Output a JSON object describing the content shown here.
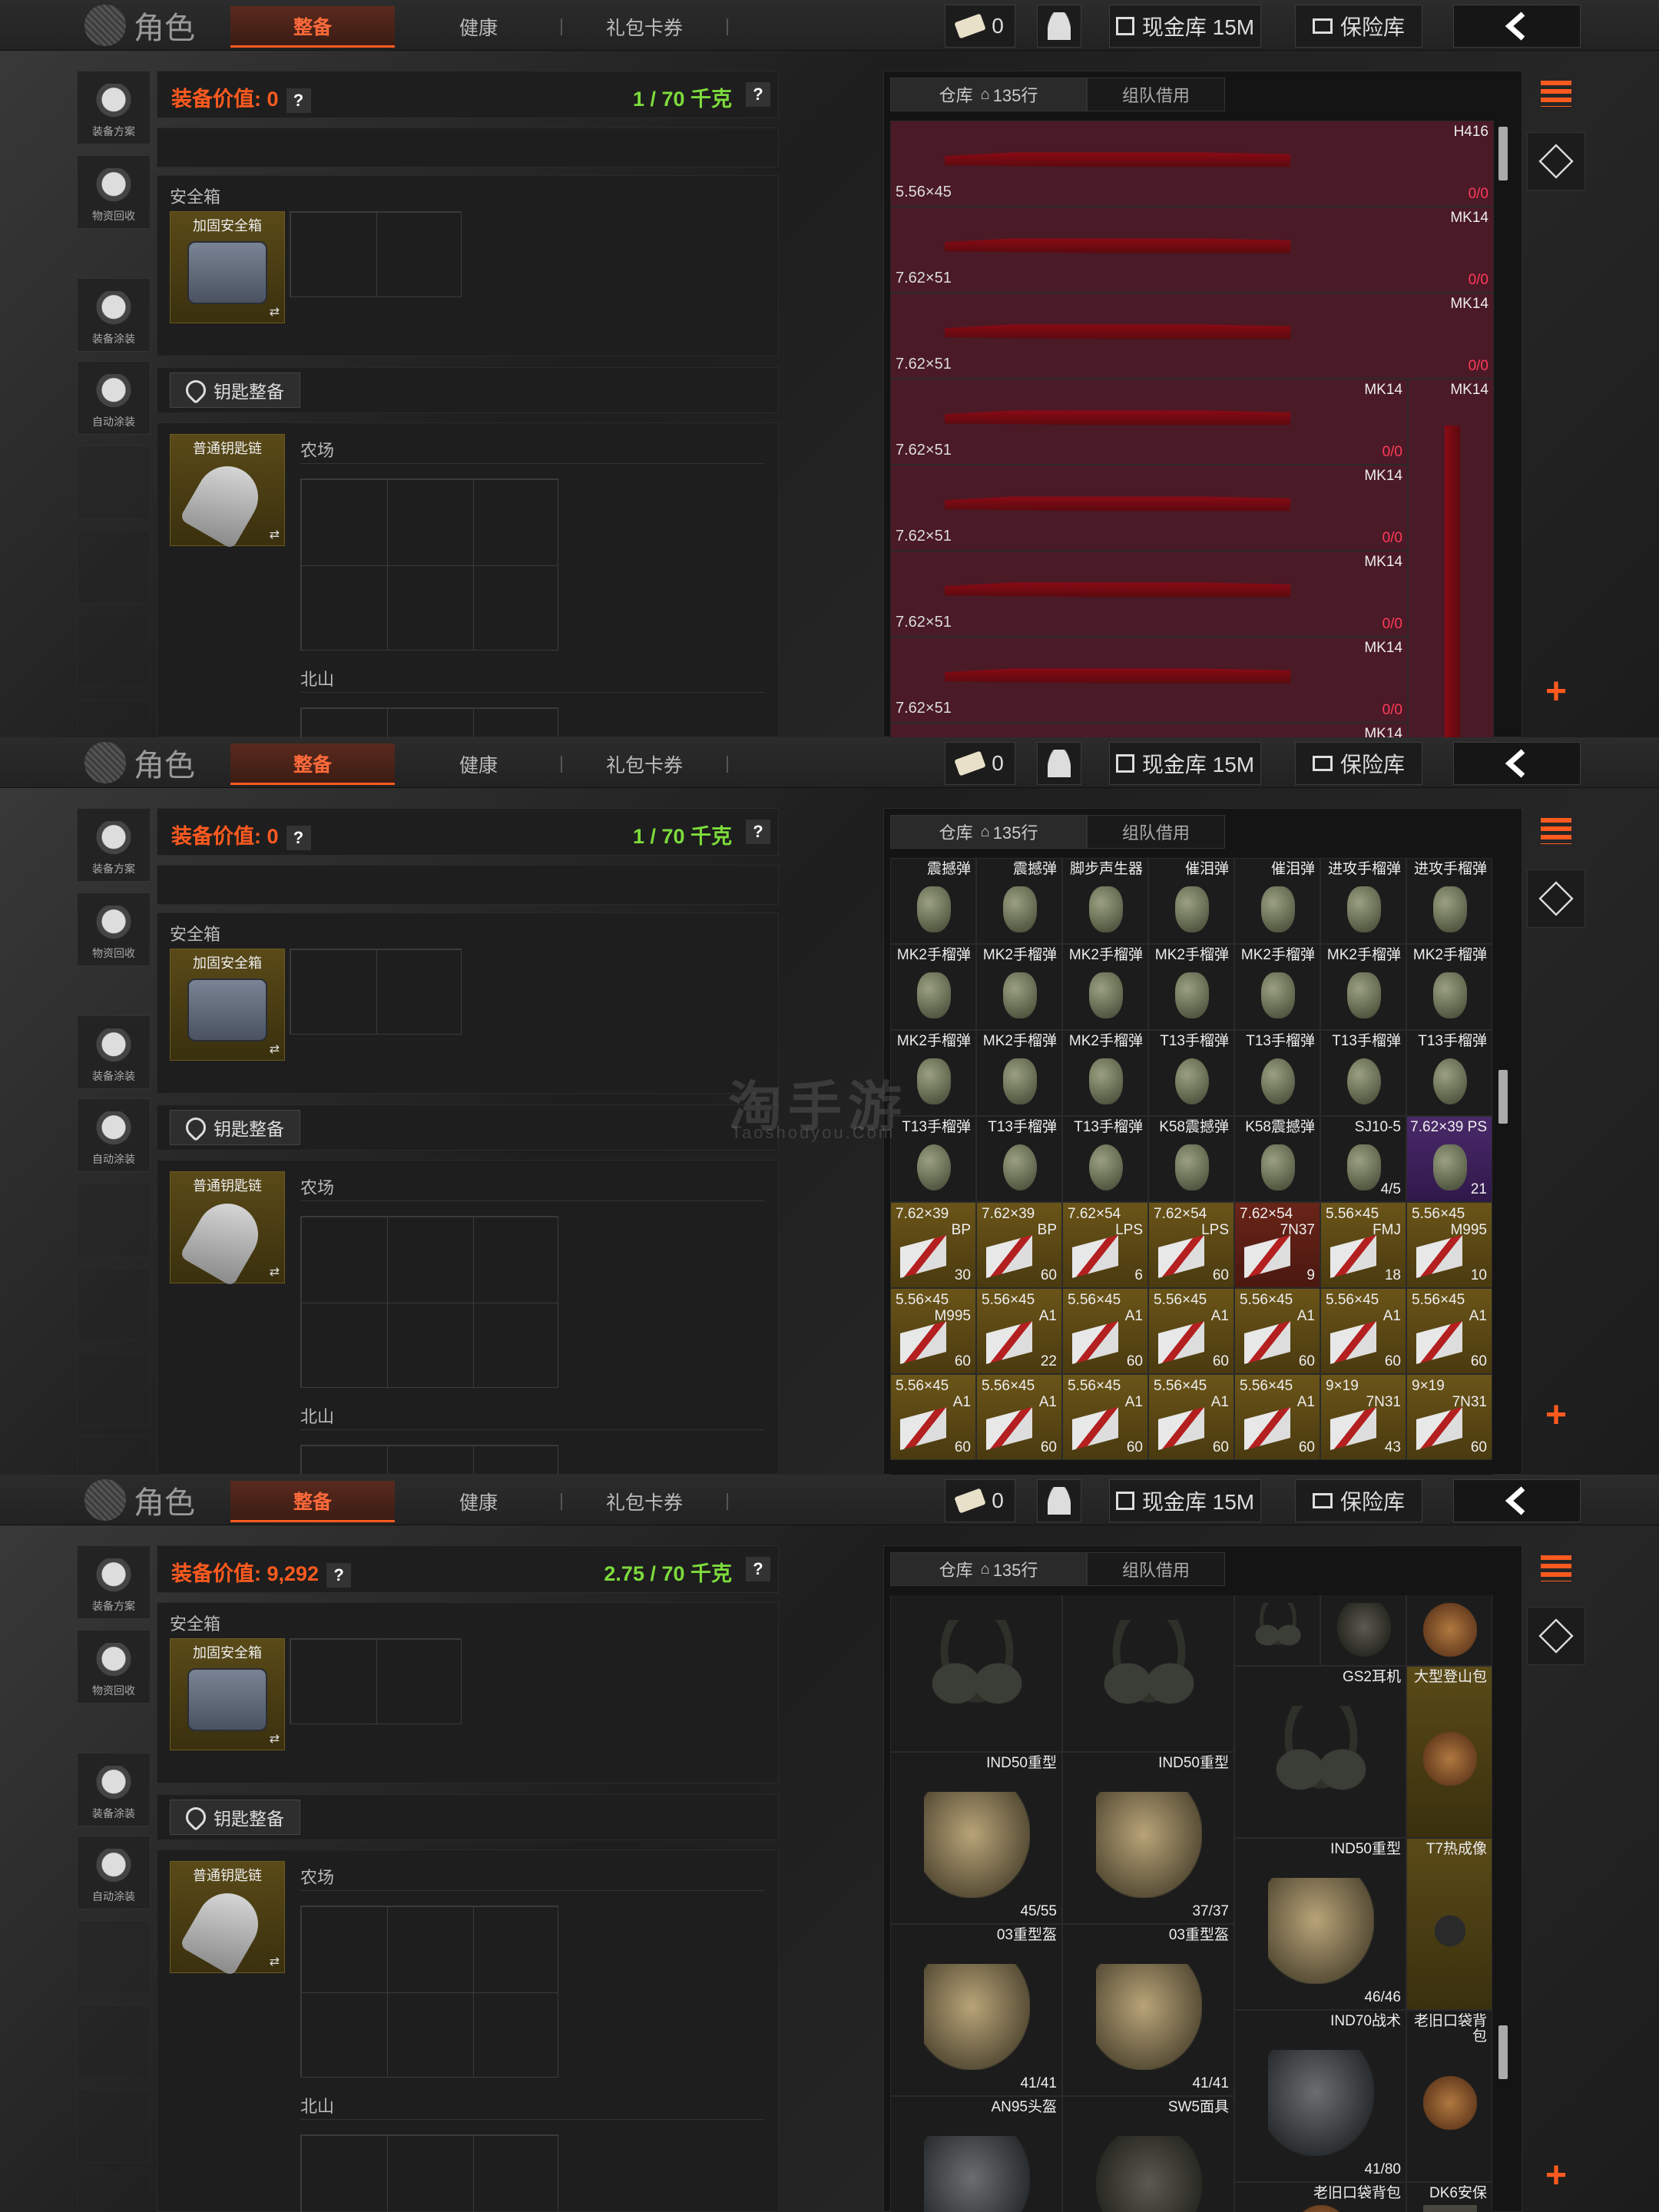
{
  "topbar": {
    "role_label": "角色",
    "tabs": [
      "整备",
      "健康",
      "礼包卡券"
    ],
    "ticket_count": "0",
    "cash_label": "现金库 15M",
    "vault_label": "保险库"
  },
  "leftbar": {
    "items": [
      "装备方案",
      "物资回收",
      "装备涂装",
      "自动涂装"
    ]
  },
  "loadout": {
    "safe_label": "安全箱",
    "safe_item": "加固安全箱",
    "key_button": "钥匙整备",
    "key_item": "普通钥匙链",
    "map1": "农场",
    "map2": "北山",
    "value_prefix": "装备价值: ",
    "weight_unit": "千克"
  },
  "inventory": {
    "tab_warehouse": "仓库",
    "row_count": "135行",
    "tab_team": "组队借用"
  },
  "panels": [
    {
      "value": "0",
      "weight": "1 / 70 千克"
    },
    {
      "value": "0",
      "weight": "1 / 70 千克"
    },
    {
      "value": "9,292",
      "weight": "2.75 / 70 千克"
    }
  ],
  "guns": [
    {
      "name": "H416",
      "ammo": "5.56×45",
      "count": "0/0"
    },
    {
      "name": "MK14",
      "ammo": "7.62×51",
      "count": "0/0"
    },
    {
      "name": "MK14",
      "ammo": "7.62×51",
      "count": "0/0"
    },
    {
      "name": "MK14",
      "ammo": "7.62×51",
      "count": "0/0"
    },
    {
      "name": "MK14",
      "ammo": "7.62×51",
      "count": "0/0"
    },
    {
      "name": "MK14",
      "ammo": "7.62×51",
      "count": "0/0"
    },
    {
      "name": "MK14",
      "ammo": "7.62×51",
      "count": "0/0"
    },
    {
      "name": "MK14",
      "ammo": "",
      "count": ""
    }
  ],
  "gun_side": "MK14",
  "grenades": [
    [
      "震撼弹",
      "震撼弹",
      "脚步声生器",
      "催泪弹",
      "催泪弹",
      "进攻手榴弹",
      "进攻手榴弹"
    ],
    [
      "MK2手榴弹",
      "MK2手榴弹",
      "MK2手榴弹",
      "MK2手榴弹",
      "MK2手榴弹",
      "MK2手榴弹",
      "MK2手榴弹"
    ],
    [
      "MK2手榴弹",
      "MK2手榴弹",
      "MK2手榴弹",
      "T13手榴弹",
      "T13手榴弹",
      "T13手榴弹",
      "T13手榴弹"
    ],
    [
      "T13手榴弹",
      "T13手榴弹",
      "T13手榴弹",
      "K58震撼弹",
      "K58震撼弹",
      "SJ10-5",
      "7.62×39 PS"
    ]
  ],
  "sj_count": "4/5",
  "ps_count": "21",
  "ammo_rows": [
    [
      [
        "7.62×39",
        "BP",
        "30"
      ],
      [
        "7.62×39",
        "BP",
        "60"
      ],
      [
        "7.62×54",
        "LPS",
        "6"
      ],
      [
        "7.62×54",
        "LPS",
        "60"
      ],
      [
        "7.62×54",
        "7N37",
        "9"
      ],
      [
        "5.56×45",
        "FMJ",
        "18"
      ],
      [
        "5.56×45",
        "M995",
        "10"
      ]
    ],
    [
      [
        "5.56×45",
        "M995",
        "60"
      ],
      [
        "5.56×45",
        "A1",
        "22"
      ],
      [
        "5.56×45",
        "A1",
        "60"
      ],
      [
        "5.56×45",
        "A1",
        "60"
      ],
      [
        "5.56×45",
        "A1",
        "60"
      ],
      [
        "5.56×45",
        "A1",
        "60"
      ],
      [
        "5.56×45",
        "A1",
        "60"
      ]
    ],
    [
      [
        "5.56×45",
        "A1",
        "60"
      ],
      [
        "5.56×45",
        "A1",
        "60"
      ],
      [
        "5.56×45",
        "A1",
        "60"
      ],
      [
        "5.56×45",
        "A1",
        "60"
      ],
      [
        "5.56×45",
        "A1",
        "60"
      ],
      [
        "9×19",
        "7N31",
        "43"
      ],
      [
        "9×19",
        "7N31",
        "60"
      ]
    ]
  ],
  "gear": {
    "gs2": "GS2耳机",
    "backpack_big": "大型登山包",
    "ind50_a": "IND50重型",
    "ind50_a_dur": "45/55",
    "ind50_b": "IND50重型",
    "ind50_b_dur": "37/37",
    "ind50_c": "IND50重型",
    "ind50_c_dur": "46/46",
    "t7": "T7热成像",
    "h03_a": "03重型盔",
    "h03_a_dur": "41/41",
    "h03_b": "03重型盔",
    "h03_b_dur": "41/41",
    "ind70": "IND70战术",
    "ind70_dur": "41/80",
    "old_bag": "老旧口袋背包",
    "an95": "AN95头盔",
    "sw5": "SW5面具",
    "old_bag2": "老旧口袋背包",
    "dk6": "DK6安保"
  },
  "watermark": {
    "cn": "淘手游",
    "en": "Taoshouyou.Com"
  },
  "colors": {
    "accent": "#ff5a1f",
    "weight_green": "#7ddc3c",
    "count_red": "#ff3a5a"
  }
}
